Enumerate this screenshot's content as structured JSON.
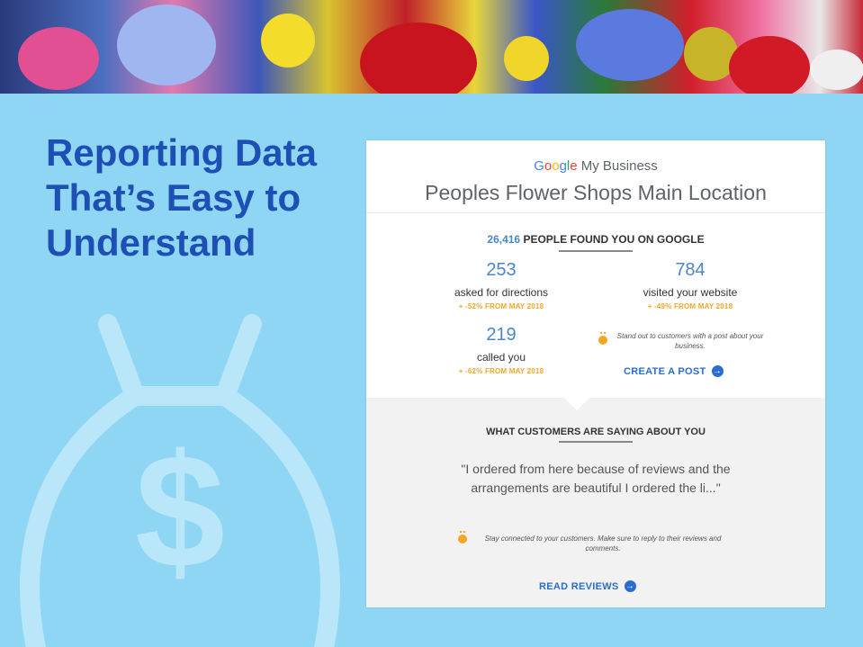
{
  "slide": {
    "title": "Reporting Data That’s Easy to Understand"
  },
  "card": {
    "brand": {
      "google": [
        "G",
        "o",
        "o",
        "g",
        "l",
        "e"
      ],
      "suffix": " My Business"
    },
    "location_name": "Peoples Flower Shops Main Location",
    "found": {
      "count": "26,416",
      "text": " PEOPLE FOUND YOU ON GOOGLE"
    },
    "stats": [
      {
        "value": "253",
        "label": "asked for directions",
        "change": "+ -52% FROM MAY 2018"
      },
      {
        "value": "784",
        "label": "visited your website",
        "change": "+ -49% FROM MAY 2018"
      },
      {
        "value": "219",
        "label": "called you",
        "change": "+ -62% FROM MAY 2018"
      }
    ],
    "post_tip": "Stand out to customers with a post about your business.",
    "create_post": "CREATE A POST",
    "reviews_heading": "WHAT CUSTOMERS ARE SAYING ABOUT YOU",
    "quote": "\"I ordered from here because of reviews and the arrangements are beautiful I ordered the li...\"",
    "reply_tip": "Stay connected to your customers. Make sure to reply to their reviews and comments.",
    "read_reviews": "READ REVIEWS"
  },
  "icons": {
    "arrow": "arrow-right-circle-icon",
    "bulb": "lightbulb-icon",
    "moneybag": "money-bag-icon"
  },
  "colors": {
    "background": "#8fd6f5",
    "title": "#1e4fb4",
    "stat_value": "#4a86c8",
    "change": "#f5a623",
    "link": "#2a6dd0"
  }
}
